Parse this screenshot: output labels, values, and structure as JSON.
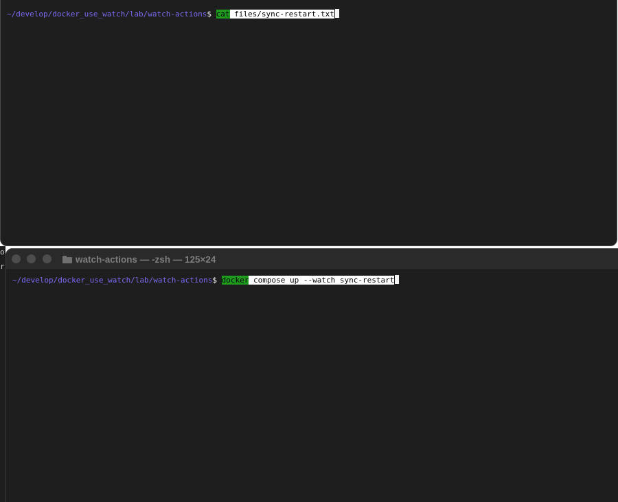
{
  "back_terminal": {
    "prompt_path": "~/develop/docker_use_watch/lab/watch-actions",
    "prompt_symbol": "$ ",
    "command": "cat",
    "arguments": " files/sync-restart.txt"
  },
  "front_terminal": {
    "window_title": "watch-actions — -zsh — 125×24",
    "folder_icon": "folder-icon",
    "prompt_path": "~/develop/docker_use_watch/lab/watch-actions",
    "prompt_symbol": "$ ",
    "command": "docker",
    "arguments": " compose up --watch sync-restart"
  },
  "edge_fragments": [
    "o",
    "r"
  ],
  "colors": {
    "terminal_bg": "#1e1e1e",
    "prompt_path": "#7b6cf2",
    "command_highlight": "#1f9c1f",
    "argument_highlight": "#ffffff",
    "title_text": "#7e7e7e"
  }
}
